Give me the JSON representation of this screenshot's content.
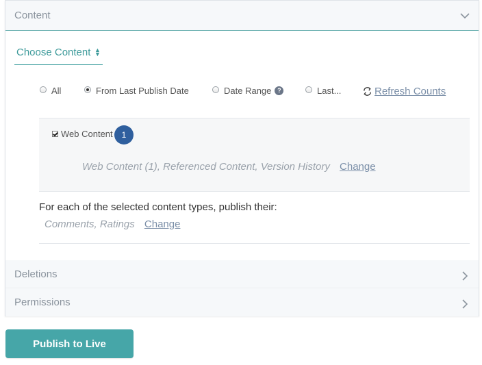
{
  "sections": {
    "content": {
      "title": "Content"
    },
    "deletions": {
      "title": "Deletions"
    },
    "permissions": {
      "title": "Permissions"
    }
  },
  "choose_content": {
    "label": "Choose Content"
  },
  "date_options": [
    {
      "label": "All",
      "checked": false
    },
    {
      "label": "From Last Publish Date",
      "checked": true
    },
    {
      "label": "Date Range",
      "checked": false
    },
    {
      "label": "Last...",
      "checked": false
    }
  ],
  "help_badge": "?",
  "refresh_counts": "Refresh Counts",
  "web_content": {
    "label": "Web Content",
    "count": "1",
    "summary": "Web Content (1), Referenced Content, Version History",
    "change": "Change"
  },
  "publish_their": {
    "text": "For each of the selected content types, publish their:",
    "summary": "Comments, Ratings",
    "change": "Change"
  },
  "publish_button": "Publish to Live",
  "colors": {
    "accent": "#46a6a8",
    "badge": "#2f5f9e",
    "link": "#7b8fa8"
  }
}
